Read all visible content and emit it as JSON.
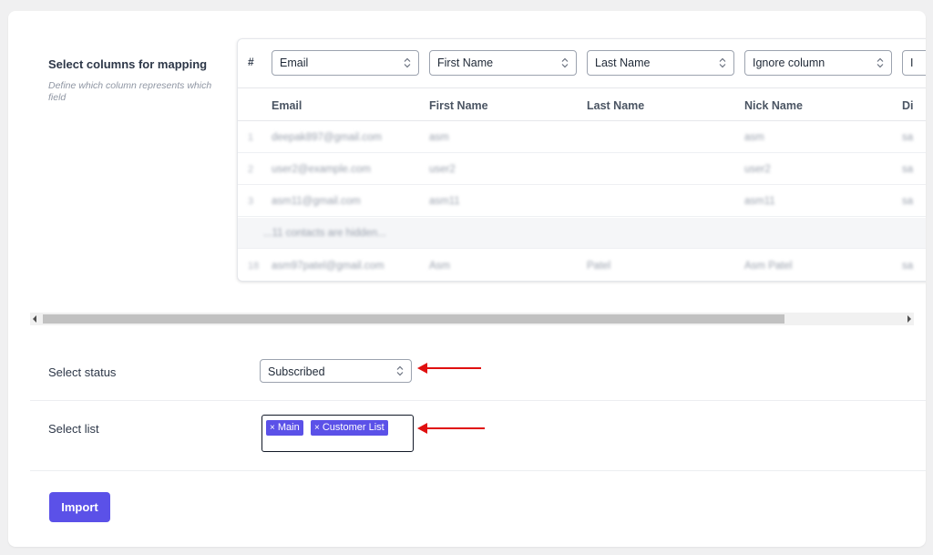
{
  "mapping": {
    "title": "Select columns for mapping",
    "description": "Define which column represents which field",
    "hash": "#",
    "selects": [
      "Email",
      "First Name",
      "Last Name",
      "Ignore column",
      "I"
    ],
    "headers": [
      "Email",
      "First Name",
      "Last Name",
      "Nick Name",
      "Di"
    ],
    "rows": [
      {
        "num": "1",
        "cells": [
          "deepak897@gmail.com",
          "asm",
          "",
          "asm",
          "sa"
        ]
      },
      {
        "num": "2",
        "cells": [
          "user2@example.com",
          "user2",
          "",
          "user2",
          "sa"
        ]
      },
      {
        "num": "3",
        "cells": [
          "asm11@gmail.com",
          "asm11",
          "",
          "asm11",
          "sa"
        ]
      },
      {
        "num": "",
        "cells": [
          "...11 contacts are hidden...",
          "",
          "",
          "",
          ""
        ]
      },
      {
        "num": "18",
        "cells": [
          "asm97patel@gmail.com",
          "Asm",
          "Patel",
          "Asm Patel",
          "sa"
        ]
      }
    ]
  },
  "status": {
    "label": "Select status",
    "value": "Subscribed"
  },
  "list": {
    "label": "Select list",
    "tags": [
      "Main",
      "Customer List"
    ]
  },
  "import_label": "Import",
  "colors": {
    "accent": "#5b51e8",
    "annotation_arrow": "#e01010"
  }
}
